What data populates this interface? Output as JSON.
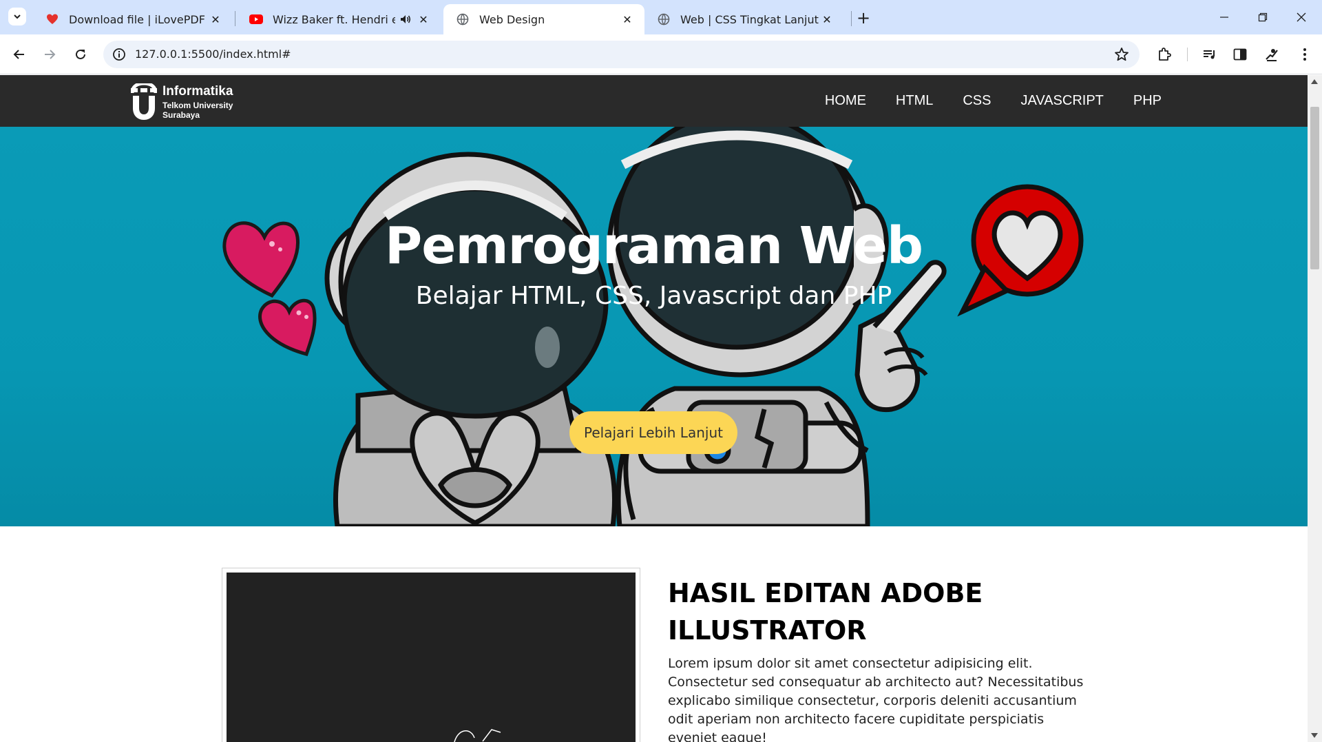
{
  "browser": {
    "tabs": [
      {
        "title": "Download file | iLovePDF",
        "icon": "ilovepdf-heart-icon",
        "active": false
      },
      {
        "title": "Wizz Baker ft. Hendri endicc",
        "icon": "youtube-icon",
        "active": false,
        "audio": true
      },
      {
        "title": "Web Design",
        "icon": "globe-icon",
        "active": true
      },
      {
        "title": "Web | CSS Tingkat Lanjut",
        "icon": "globe-icon",
        "active": false
      }
    ],
    "new_tab": "+",
    "url": "127.0.0.1:5500/index.html#",
    "accent": "#d3e3fd"
  },
  "site": {
    "logo": {
      "title": "Informatika",
      "line1": "Telkom University",
      "line2": "Surabaya"
    },
    "menu": [
      "HOME",
      "HTML",
      "CSS",
      "JAVASCRIPT",
      "PHP"
    ],
    "hero": {
      "title": "Pemrograman Web",
      "subtitle": "Belajar HTML, CSS, Javascript dan PHP",
      "button": "Pelajari Lebih Lanjut",
      "bg_color": "#0a9bb7",
      "button_color": "#fcd655"
    },
    "article": {
      "title": "HASIL EDITAN ADOBE ILLUSTRATOR",
      "body": "Lorem ipsum dolor sit amet consectetur adipisicing elit. Consectetur sed consequatur ab architecto aut? Necessitatibus explicabo similique consectetur, corporis deleniti accusantium odit aperiam non architecto facere cupiditate perspiciatis eveniet eaque!"
    }
  }
}
